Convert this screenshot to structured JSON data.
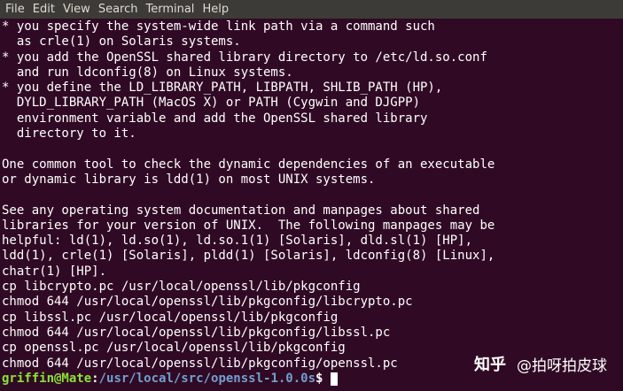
{
  "menubar": {
    "items": [
      "File",
      "Edit",
      "View",
      "Search",
      "Terminal",
      "Help"
    ]
  },
  "terminal": {
    "lines": [
      "* you specify the system-wide link path via a command such",
      "  as crle(1) on Solaris systems.",
      "* you add the OpenSSL shared library directory to /etc/ld.so.conf",
      "  and run ldconfig(8) on Linux systems.",
      "* you define the LD_LIBRARY_PATH, LIBPATH, SHLIB_PATH (HP),",
      "  DYLD_LIBRARY_PATH (MacOS X) or PATH (Cygwin and DJGPP)",
      "  environment variable and add the OpenSSL shared library",
      "  directory to it.",
      "",
      "One common tool to check the dynamic dependencies of an executable",
      "or dynamic library is ldd(1) on most UNIX systems.",
      "",
      "See any operating system documentation and manpages about shared",
      "libraries for your version of UNIX.  The following manpages may be",
      "helpful: ld(1), ld.so(1), ld.so.1(1) [Solaris], dld.sl(1) [HP],",
      "ldd(1), crle(1) [Solaris], pldd(1) [Solaris], ldconfig(8) [Linux],",
      "chatr(1) [HP].",
      "cp libcrypto.pc /usr/local/openssl/lib/pkgconfig",
      "chmod 644 /usr/local/openssl/lib/pkgconfig/libcrypto.pc",
      "cp libssl.pc /usr/local/openssl/lib/pkgconfig",
      "chmod 644 /usr/local/openssl/lib/pkgconfig/libssl.pc",
      "cp openssl.pc /usr/local/openssl/lib/pkgconfig",
      "chmod 644 /usr/local/openssl/lib/pkgconfig/openssl.pc"
    ],
    "prompt": {
      "user_host": "griffin@Mate",
      "colon": ":",
      "path": "/usr/local/src/openssl-1.0.0s",
      "symbol": "$"
    }
  },
  "watermark": {
    "logo": "知乎",
    "author": "@拍呀拍皮球"
  },
  "colors": {
    "background": "#300a24",
    "menubar": "#3c3b37",
    "prompt_user": "#8ae234",
    "prompt_path": "#729fcf",
    "text": "#ffffff"
  }
}
